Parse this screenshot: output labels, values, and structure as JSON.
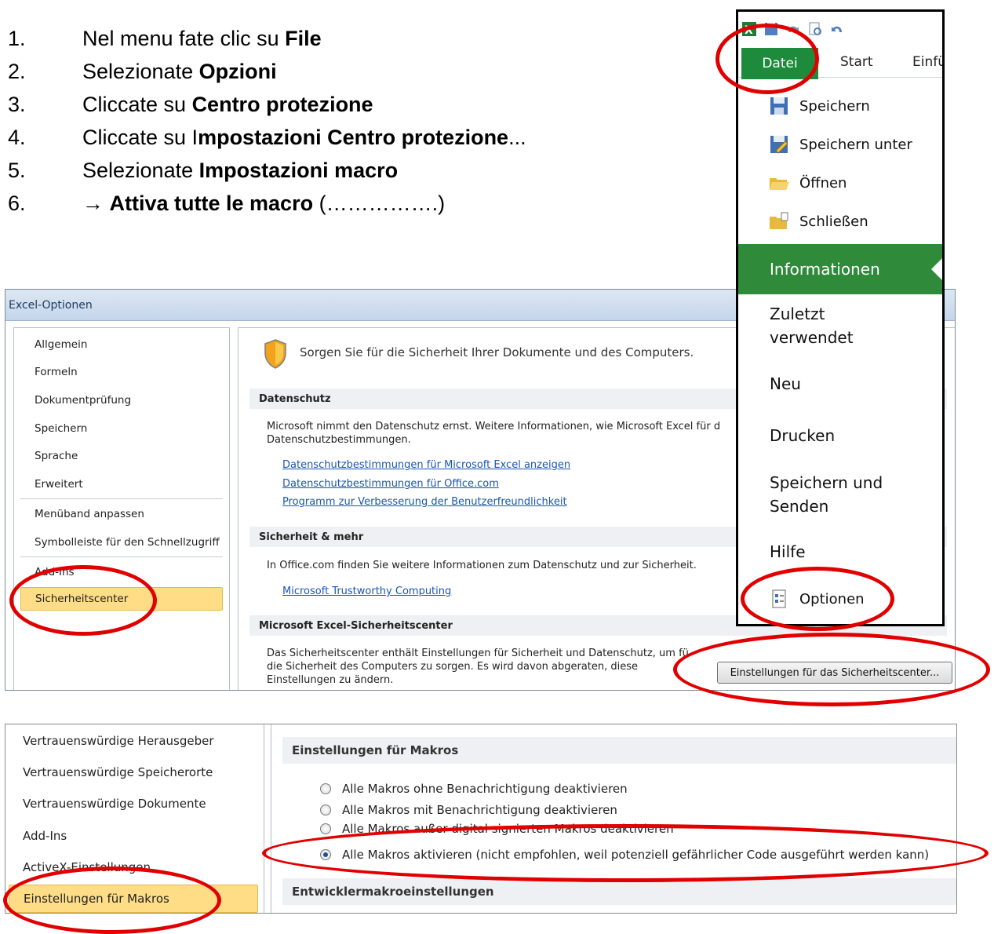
{
  "instructions": {
    "steps": [
      {
        "num": "1.",
        "pre": "Nel menu fate clic su ",
        "bold": "File",
        "post": ""
      },
      {
        "num": "2.",
        "pre": "Selezionate ",
        "bold": "Opzioni",
        "post": ""
      },
      {
        "num": "3.",
        "pre": "Cliccate su ",
        "bold": "Centro protezione",
        "post": ""
      },
      {
        "num": "4.",
        "pre": "Cliccate su I",
        "bold": "mpostazioni Centro protezione",
        "post": "..."
      },
      {
        "num": "5.",
        "pre": "Selezionate ",
        "bold": "Impostazioni macro",
        "post": ""
      },
      {
        "num": "6.",
        "pre": "→ ",
        "bold": "Attiva tutte le macro",
        "post": " (…………….)"
      }
    ]
  },
  "options_dialog": {
    "title": "Excel-Optionen",
    "nav": [
      "Allgemein",
      "Formeln",
      "Dokumentprüfung",
      "Speichern",
      "Sprache",
      "Erweitert",
      "Menüband anpassen",
      "Symbolleiste für den Schnellzugriff",
      "Add-Ins",
      "Sicherheitscenter"
    ],
    "headline": "Sorgen Sie für die Sicherheit Ihrer Dokumente und des Computers.",
    "datenschutz": {
      "header": "Datenschutz",
      "text_line1": "Microsoft nimmt den Datenschutz ernst. Weitere Informationen, wie Microsoft Excel für d",
      "text_line2": "Datenschutzbestimmungen.",
      "links": [
        "Datenschutzbestimmungen für Microsoft Excel anzeigen",
        "Datenschutzbestimmungen für Office.com",
        "Programm zur Verbesserung der Benutzerfreundlichkeit"
      ]
    },
    "sicherheit": {
      "header": "Sicherheit & mehr",
      "text": "In Office.com finden Sie weitere Informationen zum Datenschutz und zur Sicherheit.",
      "link": "Microsoft Trustworthy Computing"
    },
    "trust_center": {
      "header": "Microsoft Excel-Sicherheitscenter",
      "text_line1": "Das Sicherheitscenter enthält Einstellungen für Sicherheit und Datenschutz, um fü",
      "text_line2": "die Sicherheit des Computers zu sorgen. Es wird davon abgeraten, diese",
      "text_line3": "Einstellungen zu ändern.",
      "button": "Einstellungen für das Sicherheitscenter..."
    }
  },
  "file_menu": {
    "tabs": {
      "file": "Datei",
      "start": "Start",
      "insert": "Einfü"
    },
    "items": [
      {
        "label": "Speichern",
        "icon": "save-icon"
      },
      {
        "label": "Speichern unter",
        "icon": "save-as-icon"
      },
      {
        "label": "Öffnen",
        "icon": "open-folder-icon"
      },
      {
        "label": "Schließen",
        "icon": "close-folder-icon"
      }
    ],
    "info": "Informationen",
    "recent_line1": "Zuletzt",
    "recent_line2": "verwendet",
    "new": "Neu",
    "print": "Drucken",
    "share_line1": "Speichern und",
    "share_line2": "Senden",
    "help": "Hilfe",
    "options": "Optionen"
  },
  "macro_dialog": {
    "nav": [
      "Vertrauenswürdige Herausgeber",
      "Vertrauenswürdige Speicherorte",
      "Vertrauenswürdige Dokumente",
      "Add-Ins",
      "ActiveX-Einstellungen",
      "Einstellungen für Makros"
    ],
    "section1": "Einstellungen für Makros",
    "options": [
      "Alle Makros ohne Benachrichtigung deaktivieren",
      "Alle Makros mit Benachrichtigung deaktivieren",
      "Alle Makros außer digital signierten Makros deaktivieren",
      "Alle Makros aktivieren (nicht empfohlen, weil potenziell gefährlicher Code ausgeführt werden kann)"
    ],
    "section2": "Entwicklermakroeinstellungen"
  },
  "colors": {
    "highlight": "#e00000",
    "excel_green": "#1e8a3b",
    "selected_nav": "#ffdd87",
    "link": "#1a55b5"
  }
}
